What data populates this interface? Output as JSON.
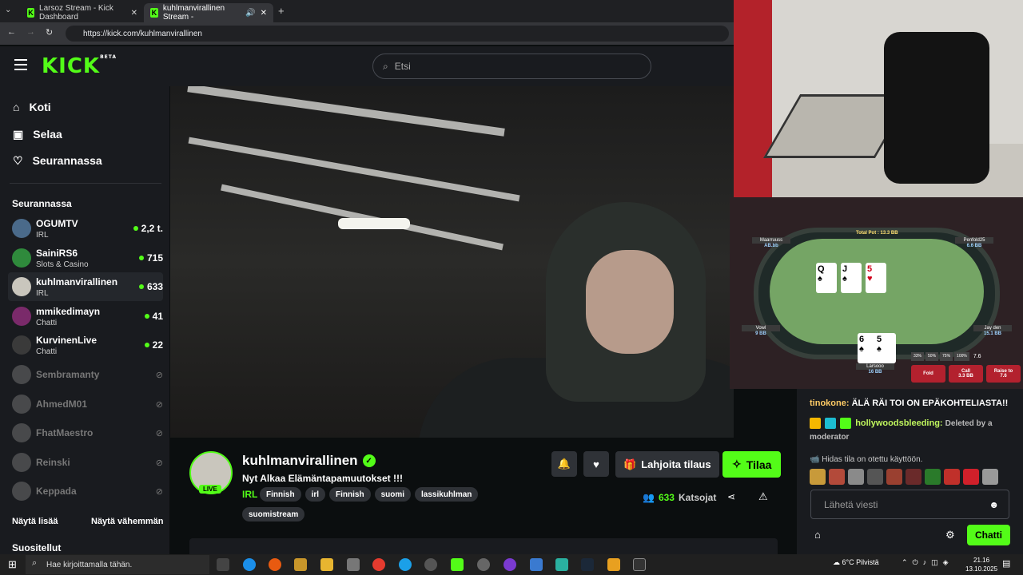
{
  "browser": {
    "tabs": [
      {
        "favicon": "K",
        "title": "Larsoz Stream - Kick Dashboard"
      },
      {
        "favicon": "K",
        "title": "kuhlmanvirallinen Stream -"
      }
    ],
    "url": "https://kick.com/kuhlmanvirallinen"
  },
  "header": {
    "logo": "KICK",
    "logo_badge": "BETA",
    "search_placeholder": "Etsi"
  },
  "sidebar": {
    "nav": [
      {
        "label": "Koti",
        "icon": "home-icon"
      },
      {
        "label": "Selaa",
        "icon": "browse-icon"
      },
      {
        "label": "Seurannassa",
        "icon": "heart-icon"
      }
    ],
    "following_title": "Seurannassa",
    "channels": [
      {
        "name": "OGUMTV",
        "category": "IRL",
        "viewers": "2,2 t.",
        "live": true,
        "color": "#4a6a8a"
      },
      {
        "name": "SainiRS6",
        "category": "Slots & Casino",
        "viewers": "715",
        "live": true,
        "color": "#2f8a3c"
      },
      {
        "name": "kuhlmanvirallinen",
        "category": "IRL",
        "viewers": "633",
        "live": true,
        "color": "#c9c6bd"
      },
      {
        "name": "mmikedimayn",
        "category": "Chatti",
        "viewers": "41",
        "live": true,
        "color": "#7a2a6a"
      },
      {
        "name": "KurvinenLive",
        "category": "Chatti",
        "viewers": "22",
        "live": true,
        "color": "#3a3a3a"
      },
      {
        "name": "Sembramanty",
        "live": false,
        "color": "#777"
      },
      {
        "name": "AhmedM01",
        "live": false,
        "color": "#777"
      },
      {
        "name": "FhatMaestro",
        "live": false,
        "color": "#777"
      },
      {
        "name": "Reinski",
        "live": false,
        "color": "#777"
      },
      {
        "name": "Keppada",
        "live": false,
        "color": "#777"
      }
    ],
    "show_more": "Näytä lisää",
    "show_less": "Näytä vähemmän",
    "recommended_title": "Suositellut"
  },
  "stream": {
    "streamer": "kuhlmanvirallinen",
    "live_label": "LIVE",
    "title": "Nyt Alkaa Elämäntapamuutokset !!!",
    "category": "IRL",
    "tags": [
      "Finnish",
      "irl",
      "Finnish",
      "suomi",
      "lassikuhlman",
      "suomistream"
    ],
    "gift_label": "Lahjoita tilaus",
    "subscribe_label": "Tilaa",
    "viewer_count": "633",
    "viewer_label": "Katsojat"
  },
  "poker": {
    "total_pot": "Total Pot : 13.3 BB",
    "players": [
      {
        "name": "Maarruuss",
        "bb": "AB.bb"
      },
      {
        "name": "Penfold25",
        "bb": "6.6 BB"
      },
      {
        "name": "Vowl",
        "bb": "9 BB"
      },
      {
        "name": "Jay den",
        "bb": "15.1 BB"
      },
      {
        "name": "Larsooo",
        "bb": "16 BB"
      }
    ],
    "board": [
      {
        "rank": "Q",
        "suit": "♠",
        "red": false
      },
      {
        "rank": "J",
        "suit": "♠",
        "red": false
      },
      {
        "rank": "5",
        "suit": "♥",
        "red": true
      }
    ],
    "hand": [
      {
        "rank": "6",
        "suit": "♠",
        "red": false
      },
      {
        "rank": "5",
        "suit": "♠",
        "red": false
      }
    ],
    "fold": "Fold",
    "call": "Call",
    "call_amount": "3.3 BB",
    "raise": "Raise to",
    "raise_amount": "7.6",
    "presets": [
      "33%",
      "50%",
      "75%",
      "100%"
    ],
    "bet_value": "7.6"
  },
  "chat": {
    "messages": [
      {
        "user": "tinokone",
        "text": "ÄLÄ RÄI TOI ON EPÄKOHTELIASTA!!"
      },
      {
        "user": "hollywoodsbleeding",
        "text": "Deleted by a moderator"
      }
    ],
    "slow_mode": "Hidas tila on otettu käyttöön.",
    "input_placeholder": "Lähetä viesti",
    "send_label": "Chatti"
  },
  "taskbar": {
    "search_placeholder": "Hae kirjoittamalla tähän.",
    "weather": "6°C Pilvistä",
    "time": "21.16",
    "date": "13.10.2025"
  }
}
